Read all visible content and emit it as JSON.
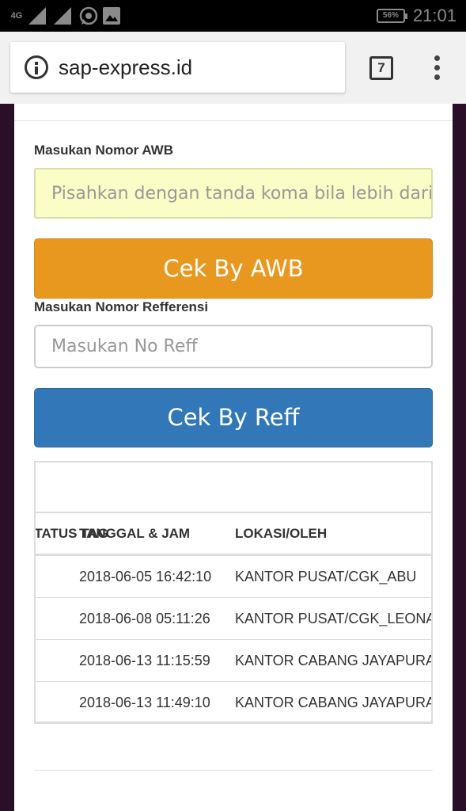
{
  "status_bar": {
    "network": "4G",
    "battery": "56%",
    "time": "21:01",
    "icons": [
      "signal-sim1-icon",
      "signal-sim2-icon",
      "whatsapp-icon",
      "gallery-icon",
      "battery-icon"
    ]
  },
  "browser": {
    "url": "sap-express.id",
    "tab_count": "7"
  },
  "form": {
    "awb_label": "Masukan Nomor AWB",
    "awb_placeholder": "Pisahkan dengan tanda koma bila lebih dari satu",
    "awb_button": "Cek By AWB",
    "reff_label": "Masukan Nomor Refferensi",
    "reff_placeholder": "Masukan No Reff",
    "reff_button": "Cek By Reff"
  },
  "colors": {
    "awb_button": "#e9981f",
    "reff_button": "#3278b8",
    "awb_input_bg": "#fafdc5"
  },
  "table": {
    "headers": [
      "STATUS TAG",
      "TANGGAL & JAM",
      "LOKASI/OLEH"
    ],
    "rows": [
      {
        "tag": "",
        "datetime": "2018-06-05 16:42:10",
        "location": "KANTOR PUSAT/CGK_ABU"
      },
      {
        "tag": "",
        "datetime": "2018-06-08 05:11:26",
        "location": "KANTOR PUSAT/CGK_LEONARDO"
      },
      {
        "tag": "",
        "datetime": "2018-06-13 11:15:59",
        "location": "KANTOR CABANG JAYAPURA/DJJ"
      },
      {
        "tag": "",
        "datetime": "2018-06-13 11:49:10",
        "location": "KANTOR CABANG JAYAPURA/DJJ"
      }
    ]
  }
}
